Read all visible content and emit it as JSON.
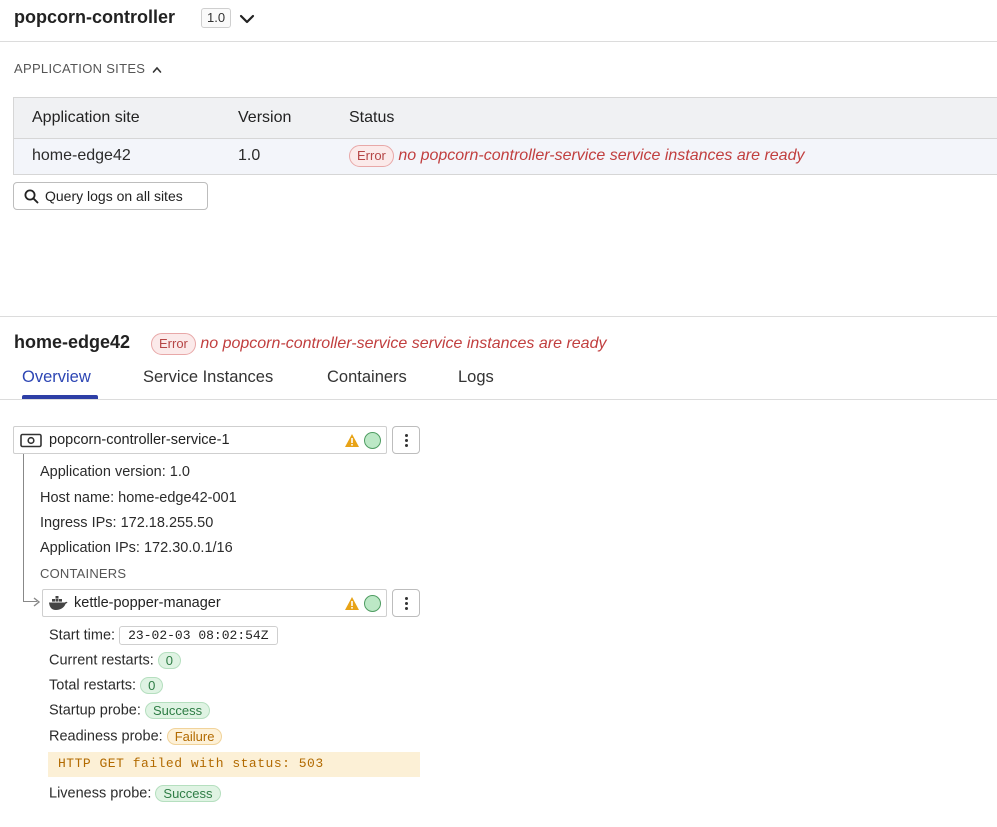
{
  "header": {
    "title": "popcorn-controller",
    "version": "1.0"
  },
  "sites_section": {
    "label": "APPLICATION SITES",
    "columns": [
      "Application site",
      "Version",
      "Status"
    ],
    "rows": [
      {
        "site": "home-edge42",
        "version": "1.0",
        "status_badge": "Error",
        "status_text": "no popcorn-controller-service service instances are ready"
      }
    ],
    "query_button": "Query logs on all sites"
  },
  "site_detail": {
    "title": "home-edge42",
    "status_badge": "Error",
    "status_text": "no popcorn-controller-service service instances are ready",
    "tabs": [
      "Overview",
      "Service Instances",
      "Containers",
      "Logs"
    ],
    "active_tab": "Overview"
  },
  "service": {
    "name": "popcorn-controller-service-1",
    "app_version": "Application version: 1.0",
    "host_name": "Host name: home-edge42-001",
    "ingress_ips": "Ingress IPs: 172.18.255.50",
    "app_ips": "Application IPs: 172.30.0.1/16",
    "containers_label": "CONTAINERS"
  },
  "container": {
    "name": "kettle-popper-manager",
    "start_time_label": "Start time:",
    "start_time": "23-02-03 08:02:54Z",
    "current_restarts_label": "Current restarts:",
    "current_restarts": "0",
    "total_restarts_label": "Total restarts:",
    "total_restarts": "0",
    "startup_probe_label": "Startup probe:",
    "startup_probe": "Success",
    "readiness_probe_label": "Readiness probe:",
    "readiness_probe": "Failure",
    "readiness_message": "HTTP GET failed with status: 503",
    "liveness_probe_label": "Liveness probe:",
    "liveness_probe": "Success"
  },
  "colors": {
    "error": "#c13f3f",
    "tab_active": "#2d46b4",
    "success": "#2e7d45",
    "warning": "#e8a317"
  }
}
